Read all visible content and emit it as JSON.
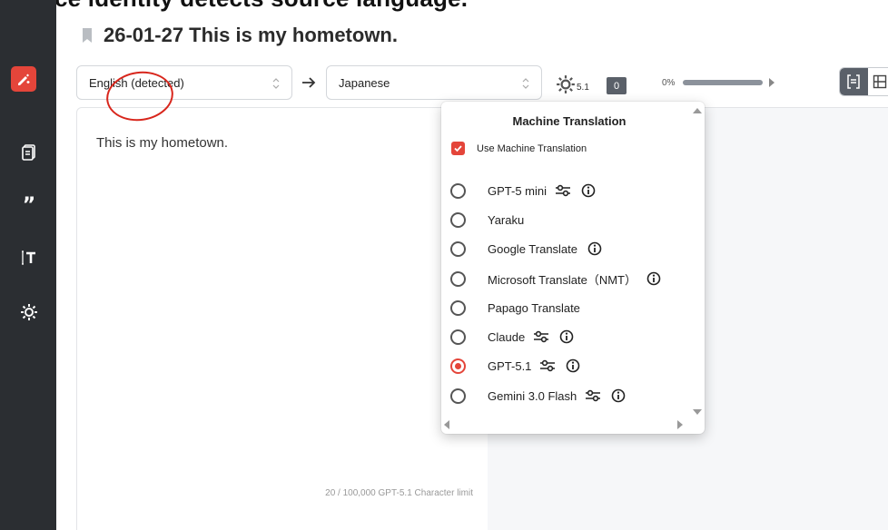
{
  "caption": "Source identity detects source language.",
  "document": {
    "title": "26-01-27 This is my hometown."
  },
  "sidebar": {
    "icons": [
      "translate-pen-icon",
      "documents-icon",
      "quote-icon",
      "text-cursor-icon",
      "settings-sun-icon"
    ]
  },
  "toolbar": {
    "source_language": "English (detected)",
    "target_language": "Japanese",
    "engine_version": "5.1",
    "doc_badge": "0",
    "progress_label": "0%",
    "progress_value": 0
  },
  "source": {
    "text": "This is my hometown.",
    "char_limit": "20 / 100,000 GPT-5.1 Character limit"
  },
  "mt_menu": {
    "title": "Machine Translation",
    "use_label": "Use Machine Translation",
    "use_checked": true,
    "options": [
      {
        "label": "GPT-5 mini",
        "settings": true,
        "info": true,
        "selected": false
      },
      {
        "label": "Yaraku",
        "settings": false,
        "info": false,
        "selected": false
      },
      {
        "label": "Google Translate",
        "settings": false,
        "info": true,
        "selected": false
      },
      {
        "label": "Microsoft Translate（NMT）",
        "settings": false,
        "info": true,
        "selected": false
      },
      {
        "label": "Papago Translate",
        "settings": false,
        "info": false,
        "selected": false
      },
      {
        "label": "Claude",
        "settings": true,
        "info": true,
        "selected": false
      },
      {
        "label": "GPT-5.1",
        "settings": true,
        "info": true,
        "selected": true
      },
      {
        "label": "Gemini 3.0 Flash",
        "settings": true,
        "info": true,
        "selected": false
      }
    ]
  },
  "colors": {
    "accent": "#e4453a",
    "sidebar": "#2b2e32",
    "annotation": "#d8261c"
  }
}
